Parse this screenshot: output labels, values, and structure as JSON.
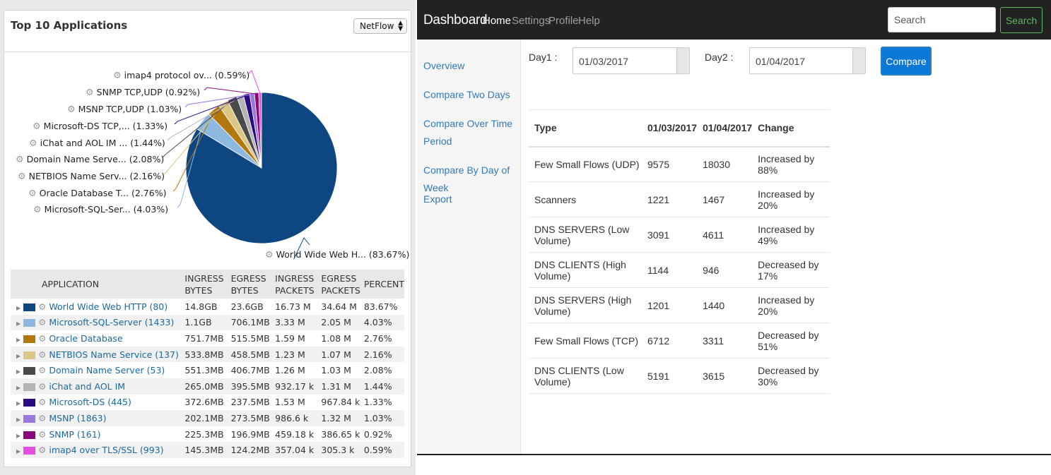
{
  "left": {
    "title": "Top 10 Applications",
    "source_select": "NetFlow",
    "pie_labels": [
      {
        "name": "imap4 protocol ov...",
        "pct": "(0.59%)"
      },
      {
        "name": "SNMP TCP,UDP",
        "pct": "(0.92%)"
      },
      {
        "name": "MSNP TCP,UDP",
        "pct": "(1.03%)"
      },
      {
        "name": "Microsoft-DS TCP,...",
        "pct": "(1.33%)"
      },
      {
        "name": "iChat and AOL IM ...",
        "pct": "(1.44%)"
      },
      {
        "name": "Domain Name Serve...",
        "pct": "(2.08%)"
      },
      {
        "name": "NETBIOS Name Serv...",
        "pct": "(2.16%)"
      },
      {
        "name": "Oracle Database T...",
        "pct": "(2.76%)"
      },
      {
        "name": "Microsoft-SQL-Ser...",
        "pct": "(4.03%)"
      },
      {
        "name": "World Wide Web H...",
        "pct": "(83.67%)"
      }
    ],
    "table": {
      "headers": {
        "application": "APPLICATION",
        "ingress_bytes_1": "INGRESS",
        "ingress_bytes_2": "BYTES",
        "egress_bytes_1": "EGRESS",
        "egress_bytes_2": "BYTES",
        "ingress_packets_1": "INGRESS",
        "ingress_packets_2": "PACKETS",
        "egress_packets_1": "EGRESS",
        "egress_packets_2": "PACKETS",
        "percent": "PERCENT"
      },
      "rows": [
        {
          "app": "World Wide Web HTTP (80)",
          "ib": "14.8GB",
          "eb": "23.6GB",
          "ip": "16.73 M",
          "ep": "34.64 M",
          "pct": "83.67%"
        },
        {
          "app": "Microsoft-SQL-Server (1433)",
          "ib": "1.1GB",
          "eb": "706.1MB",
          "ip": "3.33 M",
          "ep": "2.05 M",
          "pct": "4.03%"
        },
        {
          "app": "Oracle Database",
          "ib": "751.7MB",
          "eb": "515.5MB",
          "ip": "1.59 M",
          "ep": "1.08 M",
          "pct": "2.76%"
        },
        {
          "app": "NETBIOS Name Service (137)",
          "ib": "533.8MB",
          "eb": "458.5MB",
          "ip": "1.23 M",
          "ep": "1.07 M",
          "pct": "2.16%"
        },
        {
          "app": "Domain Name Server (53)",
          "ib": "551.3MB",
          "eb": "406.7MB",
          "ip": "1.26 M",
          "ep": "1.03 M",
          "pct": "2.08%"
        },
        {
          "app": "iChat and AOL IM",
          "ib": "265.0MB",
          "eb": "395.5MB",
          "ip": "932.17 k",
          "ep": "1.31 M",
          "pct": "1.44%"
        },
        {
          "app": "Microsoft-DS (445)",
          "ib": "372.6MB",
          "eb": "237.5MB",
          "ip": "1.53 M",
          "ep": "967.84 k",
          "pct": "1.33%"
        },
        {
          "app": "MSNP (1863)",
          "ib": "202.1MB",
          "eb": "273.5MB",
          "ip": "986.6 k",
          "ep": "1.32 M",
          "pct": "1.03%"
        },
        {
          "app": "SNMP (161)",
          "ib": "225.3MB",
          "eb": "196.9MB",
          "ip": "459.18 k",
          "ep": "386.65 k",
          "pct": "0.92%"
        },
        {
          "app": "imap4 over TLS/SSL (993)",
          "ib": "145.3MB",
          "eb": "124.2MB",
          "ip": "357.04 k",
          "ep": "305.3 k",
          "pct": "0.59%"
        }
      ]
    },
    "slice_colors": [
      "#0d4680",
      "#8db8df",
      "#b3780d",
      "#dcc786",
      "#4a4a4a",
      "#b4b4b4",
      "#2b0a82",
      "#9b78e0",
      "#8a0a7d",
      "#e84ddf"
    ],
    "slice_values": [
      83.67,
      4.03,
      2.76,
      2.16,
      2.08,
      1.44,
      1.33,
      1.03,
      0.92,
      0.59
    ]
  },
  "right": {
    "brand": "Dashboard",
    "nav": [
      "Home",
      "Settings",
      "Profile",
      "Help"
    ],
    "search_placeholder": "Search",
    "search_button": "Search",
    "sidebar": [
      "Overview",
      "Compare Two Days",
      "Compare Over Time Period",
      "Compare By Day of Week",
      "Export"
    ],
    "day1_label": "Day1 :",
    "day1_value": "01/03/2017",
    "day2_label": "Day2 :",
    "day2_value": "01/04/2017",
    "compare_button": "Compare",
    "table": {
      "headers": [
        "Type",
        "01/03/2017",
        "01/04/2017",
        "Change"
      ],
      "rows": [
        [
          "Few Small Flows (UDP)",
          "9575",
          "18030",
          "Increased by 88%"
        ],
        [
          "Scanners",
          "1221",
          "1467",
          "Increased by 20%"
        ],
        [
          "DNS SERVERS (Low Volume)",
          "3091",
          "4611",
          "Increased by 49%"
        ],
        [
          "DNS CLIENTS (High Volume)",
          "1144",
          "946",
          "Decreased by 17%"
        ],
        [
          "DNS SERVERS (High Volume)",
          "1201",
          "1440",
          "Increased by 20%"
        ],
        [
          "Few Small Flows (TCP)",
          "6712",
          "3311",
          "Decreased by 51%"
        ],
        [
          "DNS CLIENTS (Low Volume)",
          "5191",
          "3615",
          "Decreased by 30%"
        ]
      ]
    }
  }
}
